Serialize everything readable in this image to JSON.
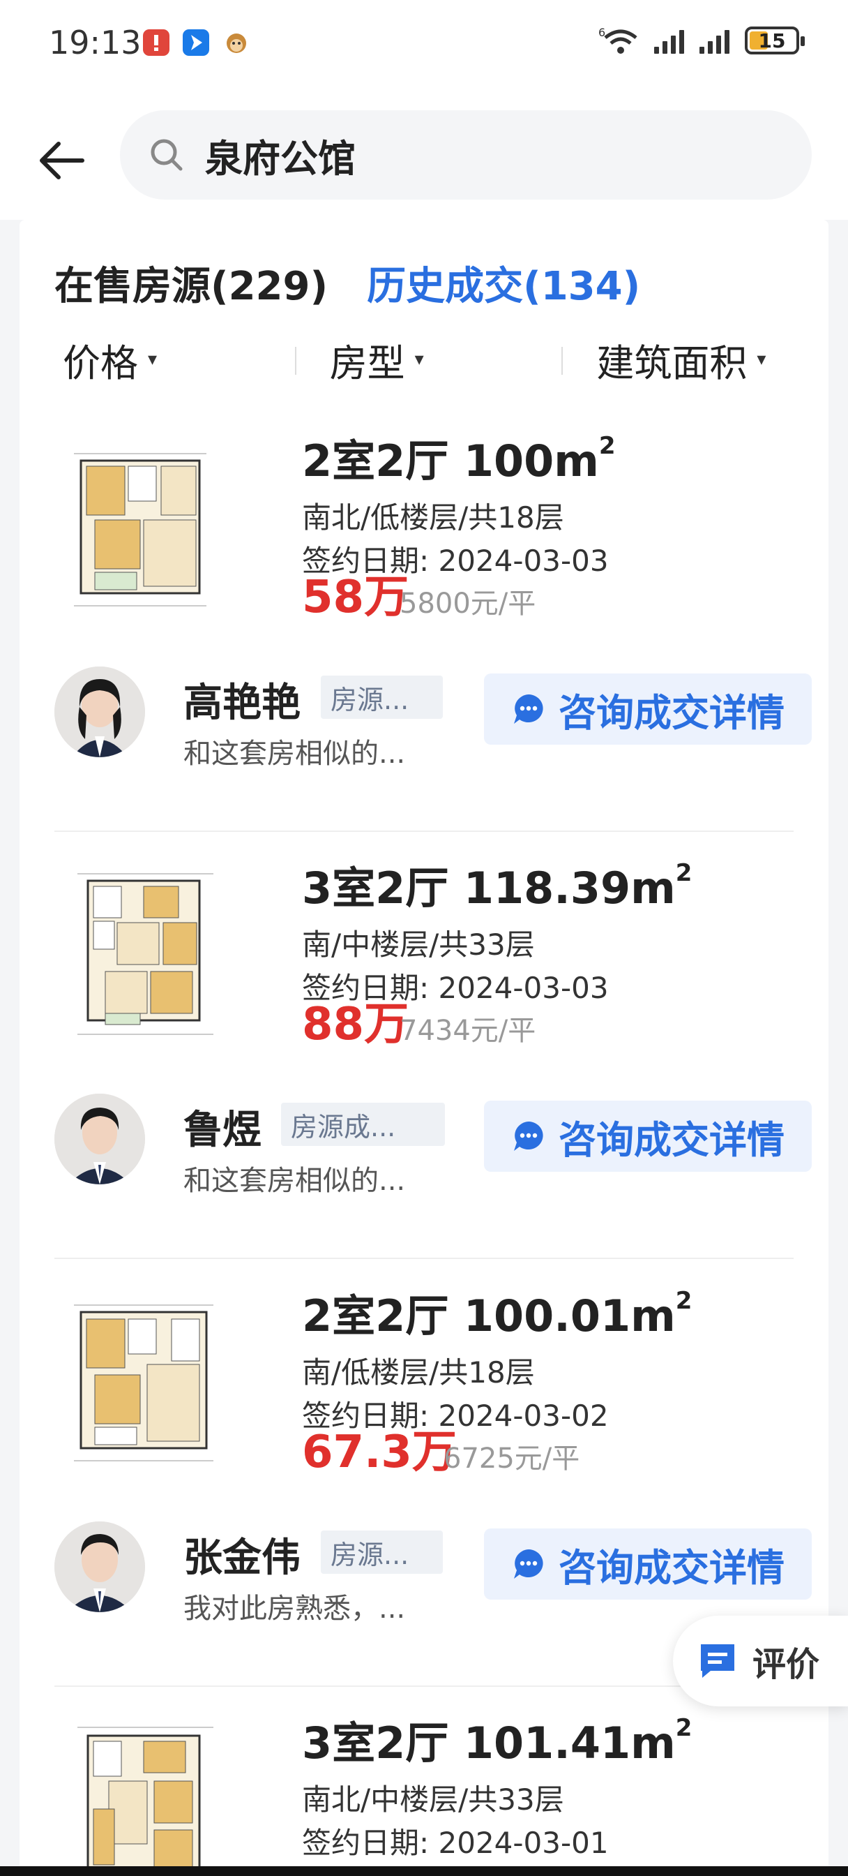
{
  "status_bar": {
    "time": "19:13",
    "battery": "15",
    "app_icons": [
      "notification-app-icon",
      "navigation-app-icon",
      "monkey-app-icon"
    ]
  },
  "header": {
    "search_text": "泉府公馆"
  },
  "tabs": [
    {
      "label": "在售房源(229)",
      "active": true
    },
    {
      "label": "历史成交(134)",
      "active": false
    }
  ],
  "filters": [
    {
      "label": "价格"
    },
    {
      "label": "房型"
    },
    {
      "label": "建筑面积"
    }
  ],
  "listings": [
    {
      "title": "2室2厅 100m",
      "sup": "2",
      "orientation": "南北/低楼层/共18层",
      "sign_date": "签约日期: 2024-03-03",
      "price": "58万",
      "unit_price": "5800元/平",
      "agent": {
        "name": "高艳艳",
        "tag": "房源...",
        "desc": "和这套房相似的..."
      },
      "button": "咨询成交详情"
    },
    {
      "title": "3室2厅 118.39m",
      "sup": "2",
      "orientation": "南/中楼层/共33层",
      "sign_date": "签约日期: 2024-03-03",
      "price": "88万",
      "unit_price": "7434元/平",
      "agent": {
        "name": "鲁煜",
        "tag": "房源成...",
        "desc": "和这套房相似的..."
      },
      "button": "咨询成交详情"
    },
    {
      "title": "2室2厅 100.01m",
      "sup": "2",
      "orientation": "南/低楼层/共18层",
      "sign_date": "签约日期: 2024-03-02",
      "price": "67.3万",
      "unit_price": "6725元/平",
      "agent": {
        "name": "张金伟",
        "tag": "房源...",
        "desc": "我对此房熟悉，..."
      },
      "button": "咨询成交详情"
    },
    {
      "title": "3室2厅 101.41m",
      "sup": "2",
      "orientation": "南北/中楼层/共33层",
      "sign_date": "签约日期: 2024-03-01"
    }
  ],
  "review_fab": {
    "label": "评价"
  },
  "colors": {
    "accent": "#2a6fe0",
    "price": "#e0302c"
  }
}
